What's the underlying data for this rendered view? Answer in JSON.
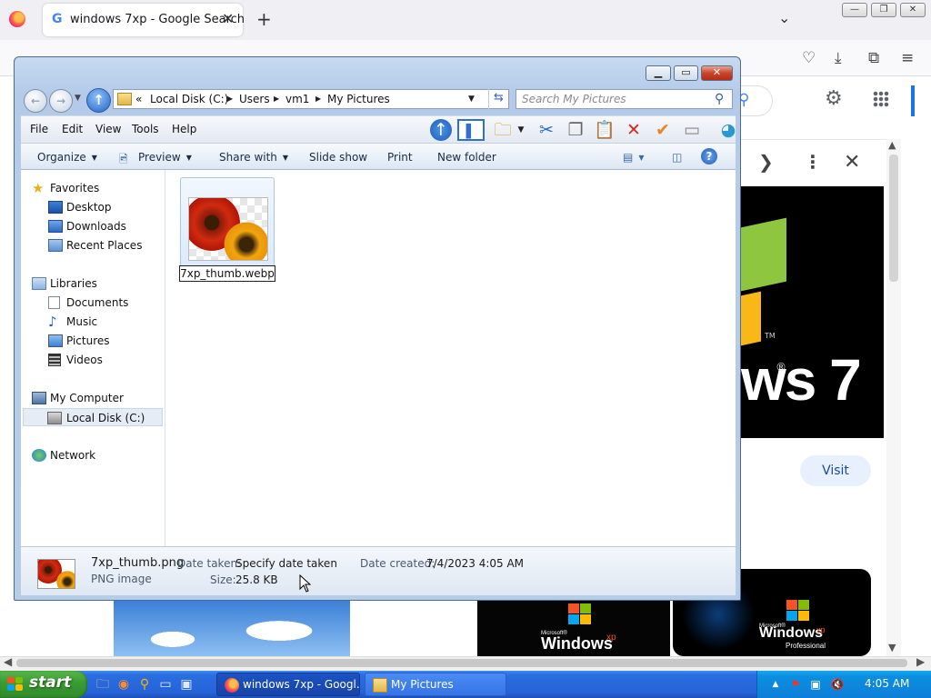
{
  "browser": {
    "tab_title": "windows 7xp - Google Search",
    "tab_close": "✕",
    "new_tab": "+",
    "tabs_list": "⌄",
    "google_g": "G"
  },
  "google": {
    "visit_button": "Visit",
    "preview_text": "ws 7",
    "thumb1_text": "Windows",
    "thumb1_sup": "xp",
    "thumb1_small": "Microsoft®",
    "thumb2_text": "Windows",
    "thumb2_sup": "xp",
    "thumb2_small": "Microsoft®",
    "thumb2_edition": "Professional"
  },
  "explorer": {
    "breadcrumb": {
      "overflow": "«",
      "items": [
        "Local Disk (C:)",
        "Users",
        "vm1",
        "My Pictures"
      ]
    },
    "search_placeholder": "Search My Pictures",
    "menu": [
      "File",
      "Edit",
      "View",
      "Tools",
      "Help"
    ],
    "command_bar": {
      "organize": "Organize",
      "preview": "Preview",
      "share_with": "Share with",
      "slide_show": "Slide show",
      "print": "Print",
      "new_folder": "New folder"
    },
    "nav_pane": {
      "favorites": "Favorites",
      "desktop": "Desktop",
      "downloads": "Downloads",
      "recent_places": "Recent Places",
      "libraries": "Libraries",
      "documents": "Documents",
      "music": "Music",
      "pictures": "Pictures",
      "videos": "Videos",
      "my_computer": "My Computer",
      "local_disk": "Local Disk (C:)",
      "network": "Network"
    },
    "file": {
      "name_edit": "7xp_thumb.webp"
    },
    "details": {
      "filename": "7xp_thumb.png",
      "type": "PNG image",
      "date_taken_label": "Date taken:",
      "date_taken_value": "Specify date taken",
      "size_label": "Size:",
      "size_value": "25.8 KB",
      "date_created_label": "Date created:",
      "date_created_value": "7/4/2023 4:05 AM"
    }
  },
  "taskbar": {
    "start": "start",
    "tasks": [
      "windows 7xp - Googl...",
      "My Pictures"
    ],
    "clock": "4:05 AM"
  },
  "colors": {
    "xp_taskbar": "#2563d8",
    "start_green": "#3a9b33",
    "explorer_frame": "#b6cde8",
    "google_blue": "#1a73e8"
  }
}
